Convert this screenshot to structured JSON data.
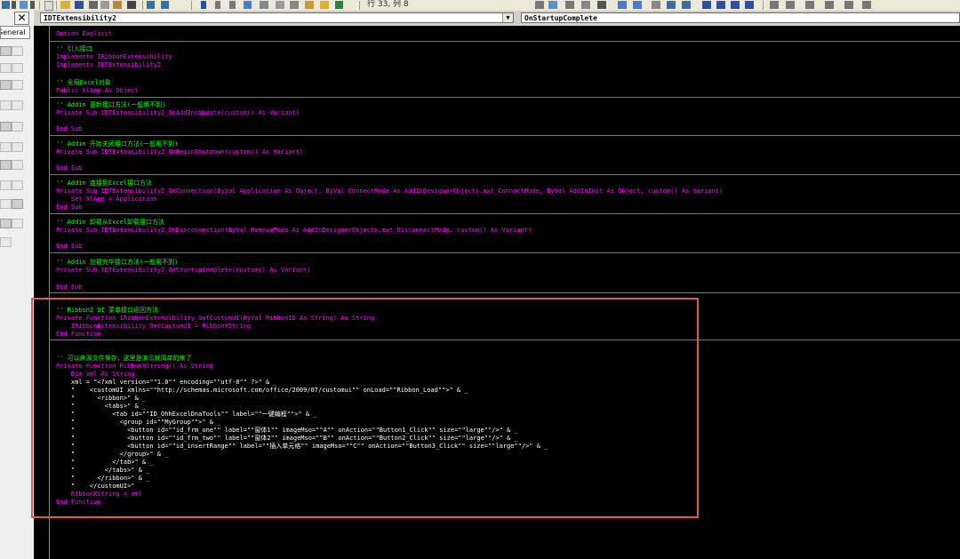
{
  "toolbar": {
    "cursor_position": "行 33, 列 8"
  },
  "left_pane": {
    "tab_label": "General",
    "close_label": "✕"
  },
  "editor": {
    "object_combo": "IDTExtensibility2",
    "procedure_combo": "OnStartupComplete",
    "lines": [
      "Option Explicit",
      "'' 引入接口",
      "Implements IRibbonExtensibility",
      "Implements IDTExtensibility2",
      "'' 全局Excel对象",
      "Public XlApp As Object",
      "'' Addin 更新接口方法(一般用不到)",
      "Private Sub IDTExtensibility2_OnAddInsUpdate(custom() As Variant)",
      "End Sub",
      "'' Addin 开始关闭接口方法(一般用不到)",
      "Private Sub IDTExtensibility2_OnBeginShutdown(custom() As Variant)",
      "End Sub",
      "'' Addin 连接到Excel接口方法",
      "Private Sub IDTExtensibility2_OnConnection(ByVal Application As Object, ByVal ConnectMode As AddInDesignerObjects.ext_ConnectMode, ByVal AddInInst As Object, custom() As Variant)",
      "    Set XlApp = Application",
      "End Sub",
      "'' Addin 卸载从Excel卸载接口方法",
      "Private Sub IDTExtensibility2_OnDisconnection(ByVal RemoveMode As AddInDesignerObjects.ext_DisconnectMode, custom() As Variant)",
      "End Sub",
      "'' Addin 加载完毕接口方法(一般用不到)",
      "Private Sub IDTExtensibility2_OnStartupComplete(custom() As Variant)",
      "End Sub",
      "'' Ribbon2 UI 菜单接口返回方法",
      "Private Function IRibbonExtensibility_GetCustomUI(ByVal RibbonID As String) As String",
      "    IRibbonExtensibility_GetCustomUI = RibbonXString",
      "End Function",
      "'' 可以来源文件保存，这里是演示就简单的来了",
      "Private Function RibbonXString() As String",
      "    Dim xml As String",
      "    xml = \"<?xml version=\"\"1.0\"\" encoding=\"\"utf-8\"\" ?>\" & _",
      "    \"    <customUI xmlns=\"\"http://schemas.microsoft.com/office/2009/07/customui\"\" onLoad=\"\"Ribbon_Load\"\">\" & _",
      "    \"      <ribbon>\" & _",
      "    \"        <tabs>\" & _",
      "    \"          <tab id=\"\"ID_OhhExcelDnaTools\"\" label=\"\"一键编程\"\">\" & _",
      "    \"            <group id=\"\"MyGroup\"\">\" & _",
      "    \"              <button id=\"\"id_frm_one\"\" label=\"\"窗体1\"\" imageMso=\"\"A\"\" onAction=\"\"Button1_Click\"\" size=\"\"large\"\"/>\" & _",
      "    \"              <button id=\"\"id_frm_two\"\" label=\"\"窗体2\"\" imageMso=\"\"B\"\" onAction=\"\"Button2_Click\"\" size=\"\"large\"\"/>\" & _",
      "    \"              <button id=\"\"id_insertRange\"\" label=\"\"插入单元格\"\" imageMso=\"\"C\"\" onAction=\"\"Button3_Click\"\" size=\"\"large\"\"/>\" & _",
      "    \"            </group>\" & _",
      "    \"          </tab>\" & _",
      "    \"        </tabs>\" & _",
      "    \"      </ribbon>\" & _",
      "    \"    </customUI>\"",
      "    RibbonXString = xml",
      "End Function"
    ]
  }
}
